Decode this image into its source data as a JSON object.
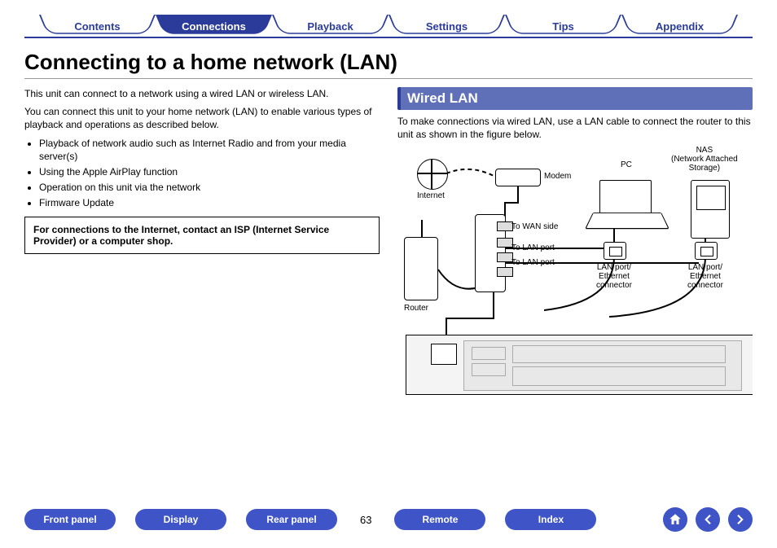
{
  "tabs": {
    "items": [
      {
        "label": "Contents",
        "active": false
      },
      {
        "label": "Connections",
        "active": true
      },
      {
        "label": "Playback",
        "active": false
      },
      {
        "label": "Settings",
        "active": false
      },
      {
        "label": "Tips",
        "active": false
      },
      {
        "label": "Appendix",
        "active": false
      }
    ]
  },
  "heading": "Connecting to a home network (LAN)",
  "left": {
    "p1": "This unit can connect to a network using a wired LAN or wireless LAN.",
    "p2": "You can connect this unit to your home network (LAN) to enable various types of playback and operations as described below.",
    "bullets": [
      "Playback of network audio such as Internet Radio and from your media server(s)",
      "Using the Apple AirPlay function",
      "Operation on this unit via the network",
      "Firmware Update"
    ],
    "note": "For connections to the Internet, contact an ISP (Internet Service Provider) or a computer shop."
  },
  "right": {
    "subheading": "Wired LAN",
    "intro": "To make connections via wired LAN, use a LAN cable to connect the router to this unit as shown in the figure below.",
    "labels": {
      "internet": "Internet",
      "modem": "Modem",
      "router": "Router",
      "to_wan": "To WAN side",
      "to_lan1": "To LAN port",
      "to_lan2": "To LAN port",
      "pc": "PC",
      "nas": "NAS\n(Network Attached\nStorage)",
      "lanport": "LAN port/\nEthernet\nconnector",
      "lanport2": "LAN port/\nEthernet\nconnector"
    }
  },
  "bottom": {
    "buttons": [
      "Front panel",
      "Display",
      "Rear panel"
    ],
    "page": "63",
    "buttons2": [
      "Remote",
      "Index"
    ]
  },
  "icons": {
    "home": "home-icon",
    "prev": "arrow-left-icon",
    "next": "arrow-right-icon"
  }
}
